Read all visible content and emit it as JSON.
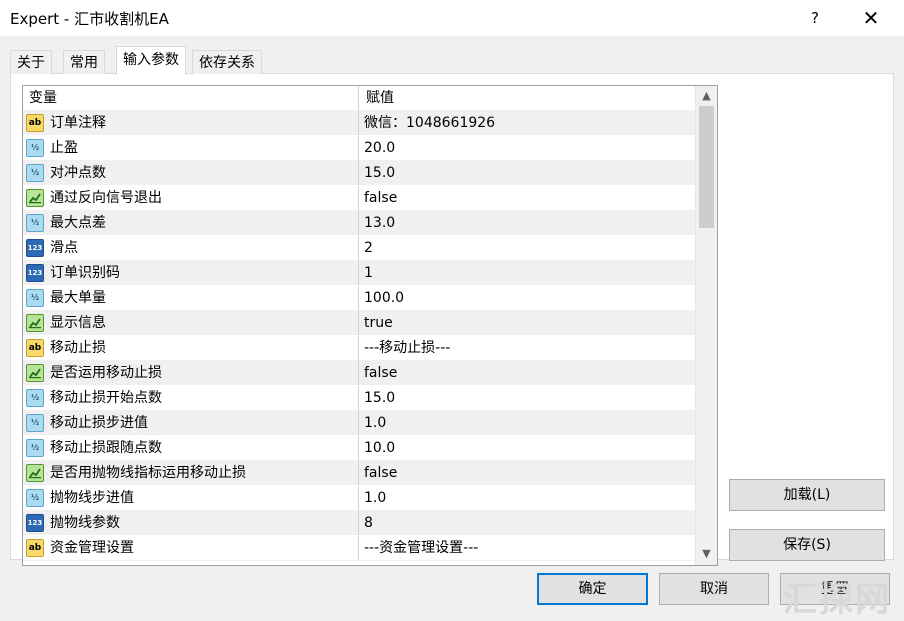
{
  "window": {
    "title": "Expert - 汇市收割机EA",
    "help_label": "?",
    "close_label": "✕"
  },
  "tabs": [
    {
      "label": "关于",
      "active": false
    },
    {
      "label": "常用",
      "active": false
    },
    {
      "label": "输入参数",
      "active": true
    },
    {
      "label": "依存关系",
      "active": false
    }
  ],
  "grid": {
    "columns": [
      "变量",
      "赋值"
    ],
    "rows": [
      {
        "icon": "string-type-icon",
        "name": "订单注释",
        "value": "微信：1048661926"
      },
      {
        "icon": "double-type-icon",
        "name": "止盈",
        "value": "20.0"
      },
      {
        "icon": "double-type-icon",
        "name": "对冲点数",
        "value": "15.0"
      },
      {
        "icon": "bool-type-icon",
        "name": "通过反向信号退出",
        "value": "false"
      },
      {
        "icon": "double-type-icon",
        "name": "最大点差",
        "value": "13.0"
      },
      {
        "icon": "int-type-icon",
        "name": "滑点",
        "value": "2"
      },
      {
        "icon": "int-type-icon",
        "name": "订单识别码",
        "value": "1"
      },
      {
        "icon": "double-type-icon",
        "name": "最大单量",
        "value": "100.0"
      },
      {
        "icon": "bool-type-icon",
        "name": "显示信息",
        "value": "true"
      },
      {
        "icon": "string-type-icon",
        "name": "移动止损",
        "value": "---移动止损---"
      },
      {
        "icon": "bool-type-icon",
        "name": "是否运用移动止损",
        "value": "false"
      },
      {
        "icon": "double-type-icon",
        "name": "移动止损开始点数",
        "value": "15.0"
      },
      {
        "icon": "double-type-icon",
        "name": "移动止损步进值",
        "value": "1.0"
      },
      {
        "icon": "double-type-icon",
        "name": "移动止损跟随点数",
        "value": "10.0"
      },
      {
        "icon": "bool-type-icon",
        "name": "是否用抛物线指标运用移动止损",
        "value": "false"
      },
      {
        "icon": "double-type-icon",
        "name": "抛物线步进值",
        "value": "1.0"
      },
      {
        "icon": "int-type-icon",
        "name": "抛物线参数",
        "value": "8"
      },
      {
        "icon": "string-type-icon",
        "name": "资金管理设置",
        "value": "---资金管理设置---"
      }
    ],
    "icon_text": {
      "string": "ab",
      "double": "½",
      "int": "123"
    }
  },
  "buttons": {
    "load": "加载(L)",
    "save": "保存(S)",
    "ok": "确定",
    "cancel": "取消",
    "reset": "重置"
  },
  "watermark": "汇探网",
  "colors": {
    "accent": "#0078d7",
    "row_alt": "#f0f0f0"
  }
}
